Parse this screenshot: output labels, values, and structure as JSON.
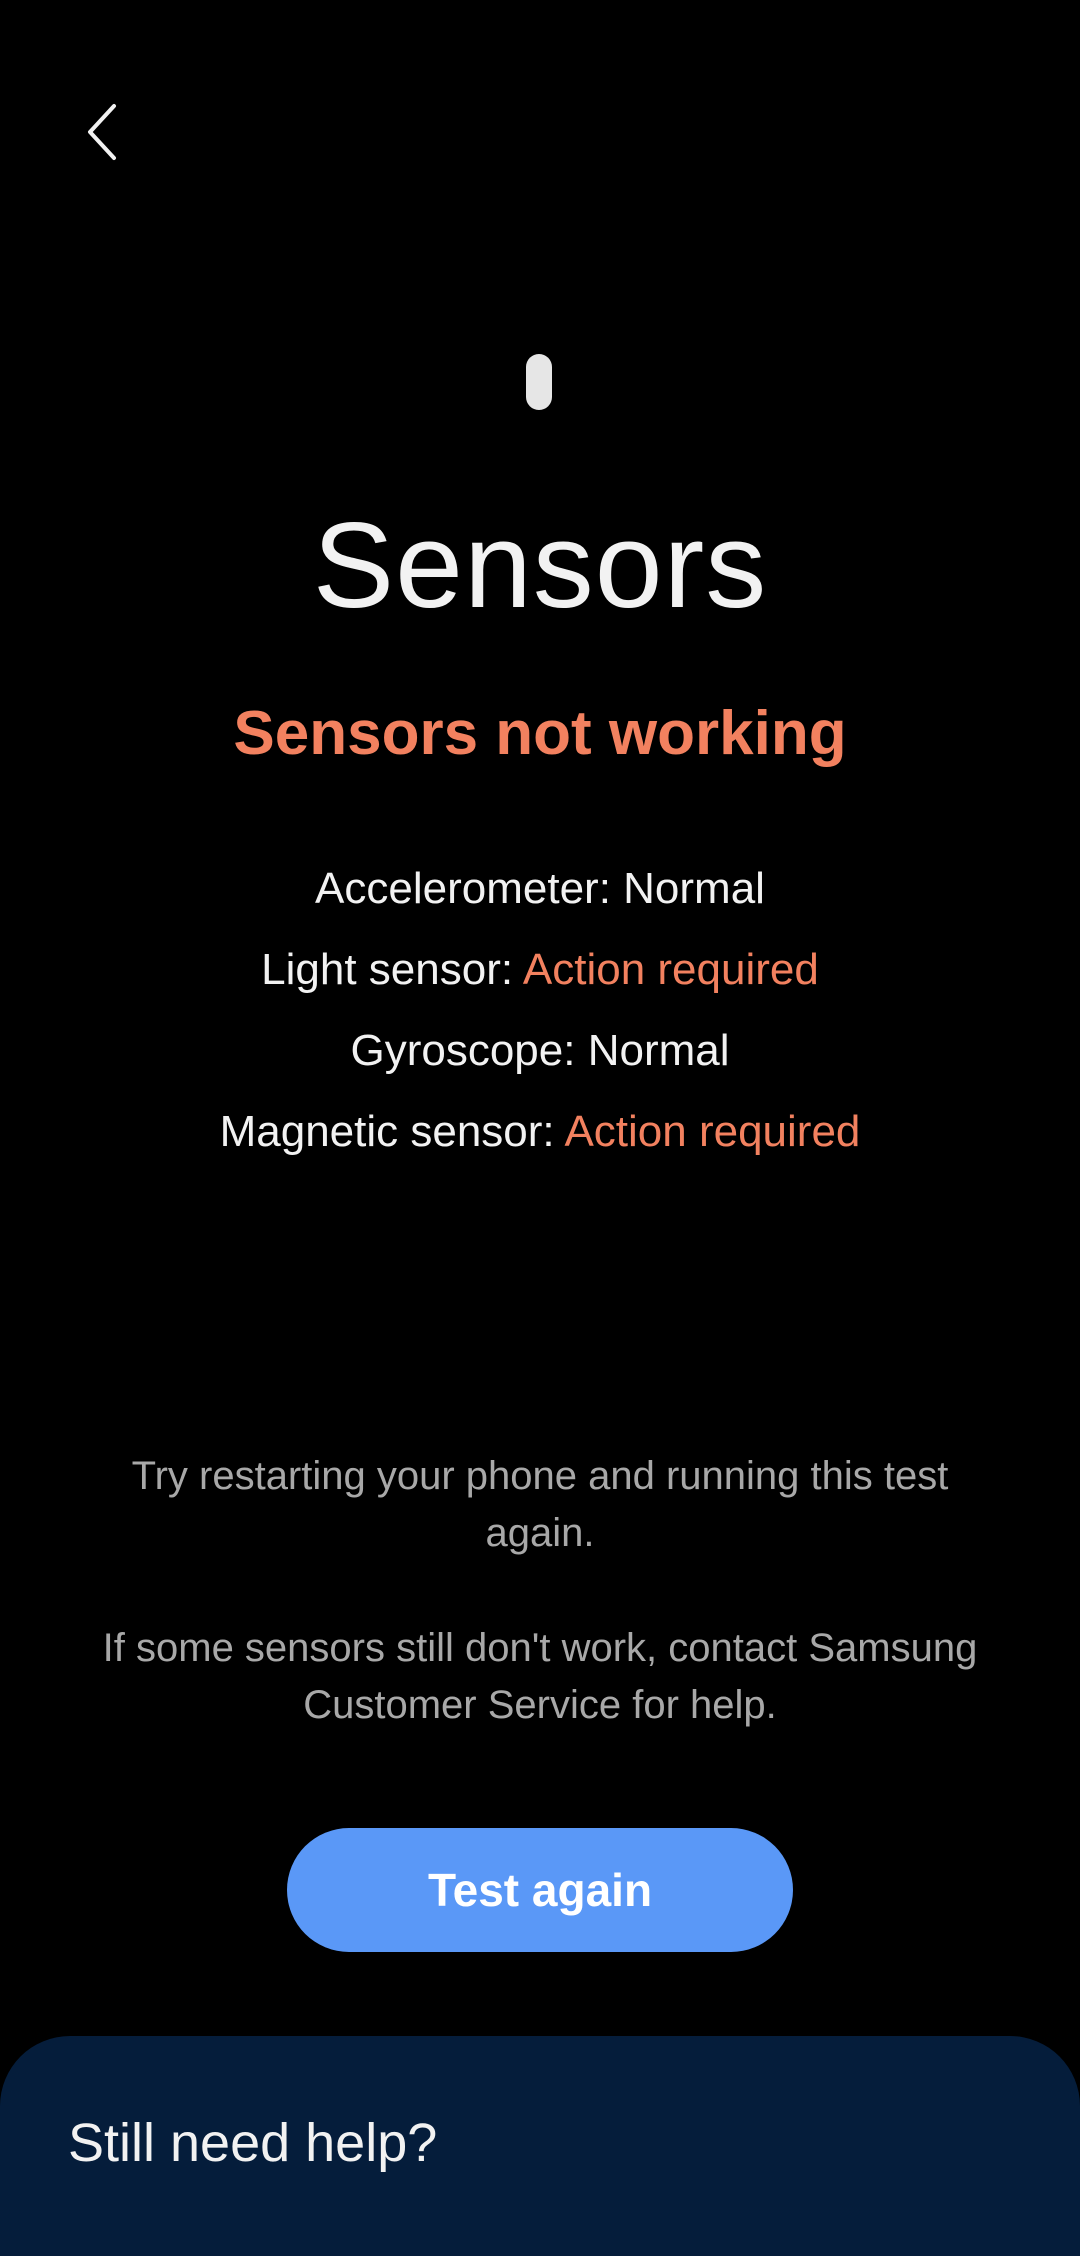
{
  "header": {
    "back_icon": "chevron-left-icon"
  },
  "page": {
    "icon": "sensor-icon",
    "title": "Sensors",
    "status": "Sensors not working",
    "status_color": "#f2815f"
  },
  "sensors": [
    {
      "name": "Accelerometer:",
      "state": "Normal"
    },
    {
      "name": "Light sensor:",
      "state": "Action required"
    },
    {
      "name": "Gyroscope:",
      "state": "Normal"
    },
    {
      "name": "Magnetic sensor:",
      "state": "Action required"
    }
  ],
  "help": {
    "restart_text": "Try restarting your phone and running this test again.",
    "contact_text": "If some sensors still don't work, contact Samsung Customer Service for help."
  },
  "actions": {
    "test_again_label": "Test again",
    "button_color": "#5a98f7"
  },
  "bottom_sheet": {
    "title": "Still need help?",
    "background_color": "#051d3b"
  }
}
